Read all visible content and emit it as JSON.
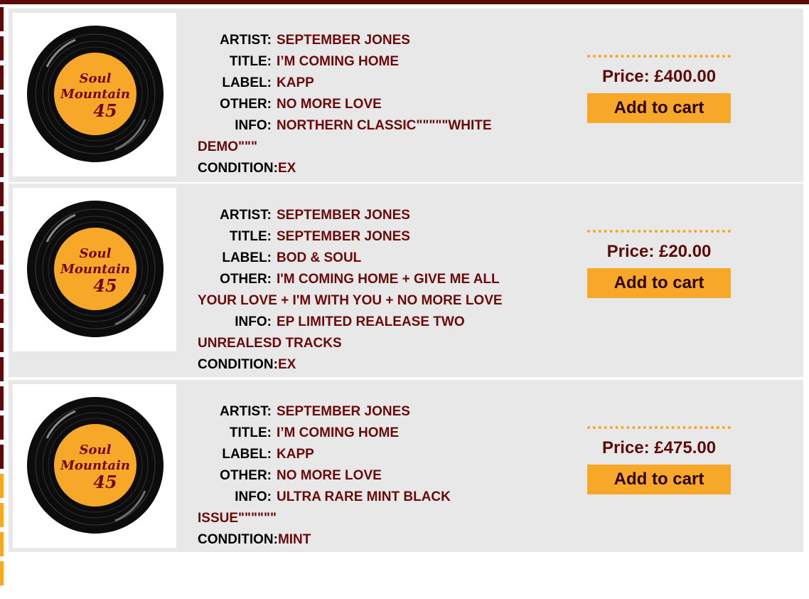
{
  "colors": {
    "accent_dark": "#5e0a0a",
    "value_text": "#6b0a0a",
    "button": "#f7a828",
    "row_bg": "#e8e8e8"
  },
  "logo": {
    "line1": "Soul",
    "line2": "Mountain",
    "line3": "45"
  },
  "field_labels": {
    "artist": "ARTIST:",
    "title": "TITLE:",
    "label": "LABEL:",
    "other": "OTHER:",
    "info": "INFO:",
    "condition": "CONDITION:"
  },
  "listings": [
    {
      "artist": "SEPTEMBER JONES",
      "title": "I’M COMING HOME",
      "label": "KAPP",
      "other": "NO MORE LOVE",
      "info": "NORTHERN CLASSIC\"\"\"\"\"WHITE DEMO\"\"\"",
      "condition": "EX",
      "price": "Price: £400.00",
      "cart_label": "Add to cart"
    },
    {
      "artist": "SEPTEMBER JONES",
      "title": "SEPTEMBER JONES",
      "label": "BOD & SOUL",
      "other": "I'M COMING HOME + GIVE ME ALL YOUR LOVE + I'M WITH YOU + NO MORE LOVE",
      "info": "EP LIMITED REALEASE TWO UNREALESD TRACKS",
      "condition": "EX",
      "price": "Price: £20.00",
      "cart_label": "Add to cart"
    },
    {
      "artist": "SEPTEMBER JONES",
      "title": "I’M COMING HOME",
      "label": "KAPP",
      "other": "NO MORE LOVE",
      "info": "ULTRA RARE MINT BLACK ISSUE\"\"\"\"\"\"",
      "condition": "MINT",
      "price": "Price: £475.00",
      "cart_label": "Add to cart"
    }
  ]
}
